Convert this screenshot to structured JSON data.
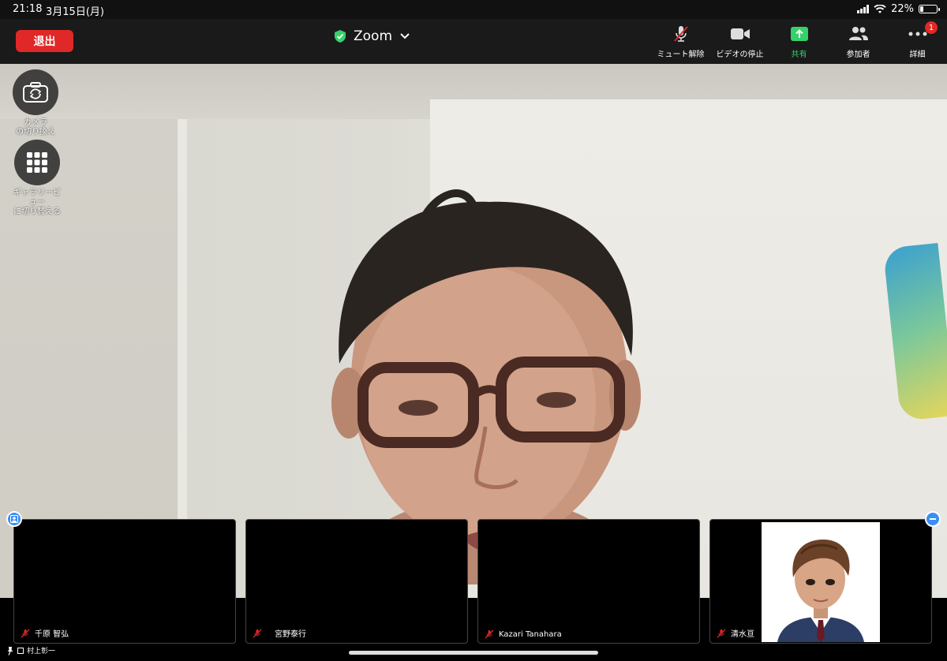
{
  "status_bar": {
    "time": "21:18",
    "date": "3月15日(月)",
    "battery": "22%",
    "battery_level": 0.22
  },
  "header": {
    "leave_label": "退出",
    "meeting_title": "Zoom",
    "toolbar": {
      "mute_label": "ミュート解除",
      "video_label": "ビデオの停止",
      "share_label": "共有",
      "participants_label": "参加者",
      "more_label": "詳細",
      "more_badge": "1"
    }
  },
  "side_controls": {
    "camera_switch_label": "カメラ\nの切り換え",
    "gallery_label": "ギャラリービ\nュー\nに切り替える"
  },
  "participants": [
    {
      "name": "千原 智弘",
      "muted": true
    },
    {
      "name": "宮野泰行",
      "muted": true
    },
    {
      "name": "Kazari Tanahara",
      "muted": true
    },
    {
      "name": "清水亘",
      "muted": true,
      "has_avatar": true
    }
  ],
  "self_view_label": "村上彰一",
  "colors": {
    "leave": "#e02828",
    "share_green": "#35d16a",
    "accent_blue": "#3a8ff5",
    "mute_red": "#e02828"
  }
}
